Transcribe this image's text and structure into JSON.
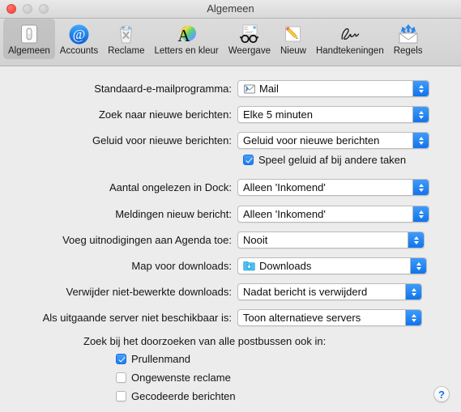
{
  "window": {
    "title": "Algemeen",
    "traffic_lights": [
      "close",
      "minimize",
      "zoom"
    ]
  },
  "toolbar": {
    "tabs": [
      {
        "id": "algemeen",
        "label": "Algemeen",
        "icon": "general-switch-icon",
        "selected": true
      },
      {
        "id": "accounts",
        "label": "Accounts",
        "icon": "at-sign-icon",
        "selected": false
      },
      {
        "id": "reclame",
        "label": "Reclame",
        "icon": "trash-junk-icon",
        "selected": false
      },
      {
        "id": "letters",
        "label": "Letters en kleur",
        "icon": "font-color-icon",
        "selected": false
      },
      {
        "id": "weergave",
        "label": "Weergave",
        "icon": "glasses-viewing-icon",
        "selected": false
      },
      {
        "id": "nieuw",
        "label": "Nieuw",
        "icon": "pencil-compose-icon",
        "selected": false
      },
      {
        "id": "handtekeningen",
        "label": "Handtekeningen",
        "icon": "signature-icon",
        "selected": false
      },
      {
        "id": "regels",
        "label": "Regels",
        "icon": "rules-envelope-arrows-icon",
        "selected": false
      }
    ]
  },
  "form": {
    "rows": [
      {
        "label": "Standaard-e-mailprogramma:",
        "value": "Mail",
        "icon": "mail-app-icon"
      },
      {
        "label": "Zoek naar nieuwe berichten:",
        "value": "Elke 5 minuten",
        "icon": null
      },
      {
        "label": "Geluid voor nieuwe berichten:",
        "value": "Geluid voor nieuwe berichten",
        "icon": null
      },
      {
        "label": "Aantal ongelezen in Dock:",
        "value": "Alleen 'Inkomend'",
        "icon": null
      },
      {
        "label": "Meldingen nieuw bericht:",
        "value": "Alleen 'Inkomend'",
        "icon": null
      },
      {
        "label": "Voeg uitnodigingen aan Agenda toe:",
        "value": "Nooit",
        "icon": null
      },
      {
        "label": "Map voor downloads:",
        "value": "Downloads",
        "icon": "downloads-folder-icon"
      },
      {
        "label": "Verwijder niet-bewerkte downloads:",
        "value": "Nadat bericht is verwijderd",
        "icon": null
      },
      {
        "label": "Als uitgaande server niet beschikbaar is:",
        "value": "Toon alternatieve servers",
        "icon": null
      }
    ],
    "sound_other_tasks": {
      "label": "Speel geluid af bij andere taken",
      "checked": true
    },
    "search_section": {
      "heading": "Zoek bij het doorzoeken van alle postbussen ook in:",
      "options": [
        {
          "label": "Prullenmand",
          "checked": true
        },
        {
          "label": "Ongewenste reclame",
          "checked": false
        },
        {
          "label": "Gecodeerde berichten",
          "checked": false
        }
      ]
    }
  },
  "help": {
    "label": "?"
  },
  "colors": {
    "accent_blue": "#1174ec",
    "window_bg": "#ececec",
    "toolbar_bg": "#d6d6d6",
    "text": "#141414"
  }
}
